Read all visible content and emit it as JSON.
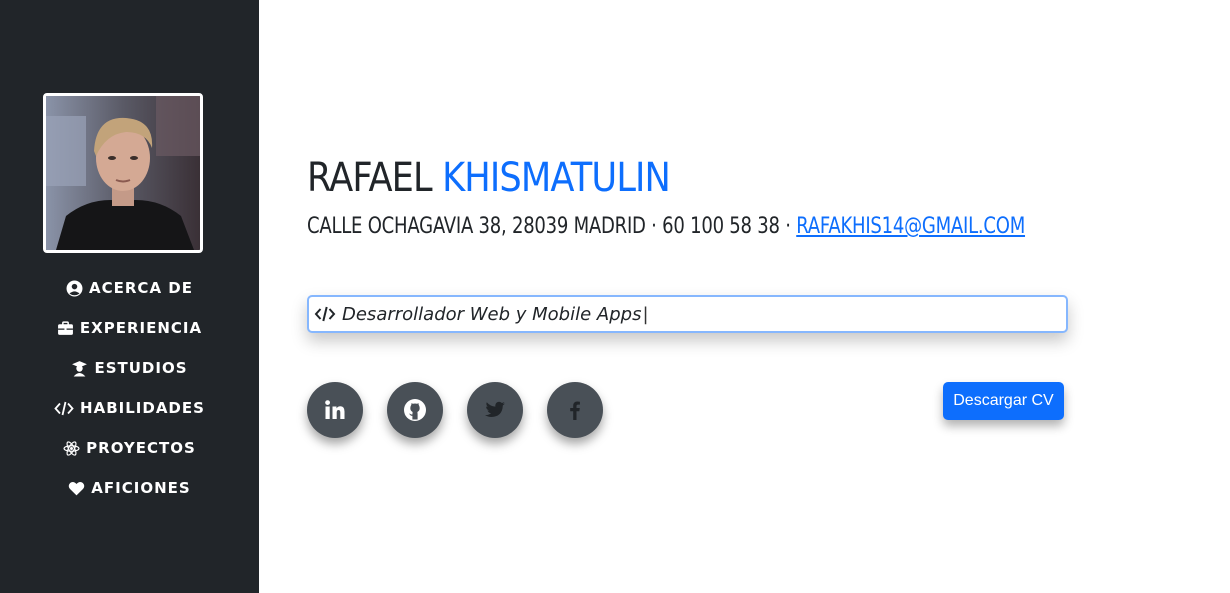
{
  "sidebar": {
    "avatar_alt": "profile photo",
    "items": [
      {
        "label": "ACERCA DE",
        "icon": "user-circle-icon"
      },
      {
        "label": "EXPERIENCIA",
        "icon": "briefcase-icon"
      },
      {
        "label": "ESTUDIOS",
        "icon": "graduate-icon"
      },
      {
        "label": "HABILIDADES",
        "icon": "code-icon"
      },
      {
        "label": "PROYECTOS",
        "icon": "react-icon"
      },
      {
        "label": "AFICIONES",
        "icon": "heart-icon"
      }
    ]
  },
  "header": {
    "first_name": "RAFAEL",
    "last_name": "KHISMATULIN",
    "address": "CALLE OCHAGAVIA 38, 28039 MADRID",
    "phone": "60 100 58 38",
    "separator": "·",
    "email": "RAFAKHIS14@GMAIL.COM"
  },
  "tagline": {
    "text": "Desarrollador Web y Mobile Apps",
    "caret": "|",
    "icon": "code-icon"
  },
  "social": [
    {
      "name": "linkedin",
      "icon": "linkedin-icon"
    },
    {
      "name": "github",
      "icon": "github-icon"
    },
    {
      "name": "twitter",
      "icon": "twitter-icon"
    },
    {
      "name": "facebook",
      "icon": "facebook-icon"
    }
  ],
  "download_button": "Descargar CV",
  "colors": {
    "sidebar_bg": "#212529",
    "accent": "#0d6efd",
    "social_bg": "#495057",
    "text": "#212529"
  }
}
